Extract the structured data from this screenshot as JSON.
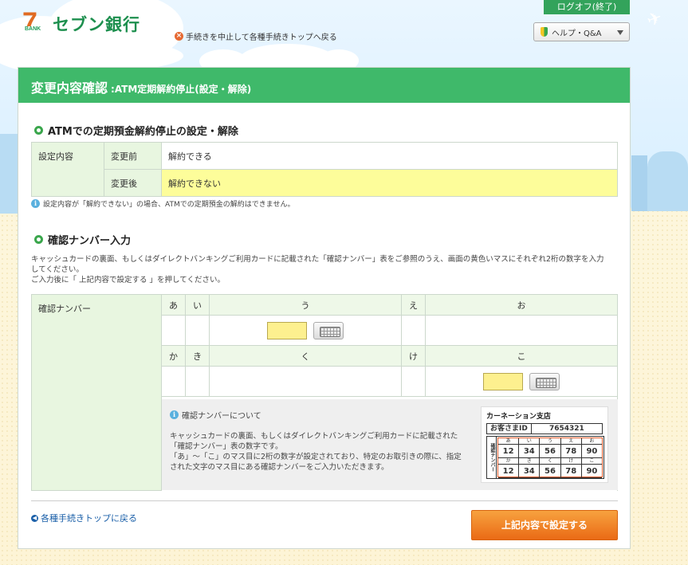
{
  "header": {
    "bank_logo_mark": "7",
    "bank_logo_sub": "BANK",
    "bank_name": "セブン銀行",
    "abort_link": "手続きを中止して各種手続きトップへ戻る",
    "logout": "ログオフ(終了)",
    "help": "ヘルプ・Q&A"
  },
  "page": {
    "title_main": "変更内容確認",
    "title_sub": ":ATM定期解約停止(設定・解除)"
  },
  "section1": {
    "heading": "ATMでの定期預金解約停止の設定・解除",
    "row_label": "設定内容",
    "before_label": "変更前",
    "before_value": "解約できる",
    "after_label": "変更後",
    "after_value": "解約できない",
    "note": "設定内容が「解約できない」の場合、ATMでの定期預金の解約はできません。"
  },
  "section2": {
    "heading": "確認ナンバー入力",
    "desc_line1": "キャッシュカードの裏面、もしくはダイレクトバンキングご利用カードに記載された「確認ナンバー」表をご参照のうえ、画面の黄色いマスにそれぞれ2桁の数字を入力",
    "desc_line2": "してください。",
    "desc_line3": "ご入力後に「 上記内容で設定する 」を押してください。",
    "row_label": "確認ナンバー",
    "kana_row1": [
      "あ",
      "い",
      "う",
      "え",
      "お"
    ],
    "kana_row2": [
      "か",
      "き",
      "く",
      "け",
      "こ"
    ],
    "input_u_value": "",
    "input_ko_value": ""
  },
  "about": {
    "heading": "確認ナンバーについて",
    "line1": "キャッシュカードの裏面、もしくはダイレクトバンキングご利用カードに記載された",
    "line2": "「確認ナンバー」表の数字です。",
    "line3": "「あ」～「こ」のマス目に2桁の数字が設定されており、特定のお取引きの際に、指定",
    "line4": "された文字のマス目にある確認ナンバーをご入力いただきます。"
  },
  "sample_card": {
    "branch": "カーネーション支店",
    "cust_label": "お客さまID",
    "cust_id": "7654321",
    "side_label": "確認ナンバー",
    "kana1": [
      "あ",
      "い",
      "う",
      "え",
      "お"
    ],
    "nums1": [
      "12",
      "34",
      "56",
      "78",
      "90"
    ],
    "kana2": [
      "か",
      "き",
      "く",
      "け",
      "こ"
    ],
    "nums2": [
      "12",
      "34",
      "56",
      "78",
      "90"
    ]
  },
  "footer": {
    "back_link": "各種手続きトップに戻る",
    "submit": "上記内容で設定する"
  },
  "colors": {
    "brand_green": "#3fb96a",
    "submit_orange": "#ea6a15",
    "input_yellow": "#fdf08f"
  }
}
